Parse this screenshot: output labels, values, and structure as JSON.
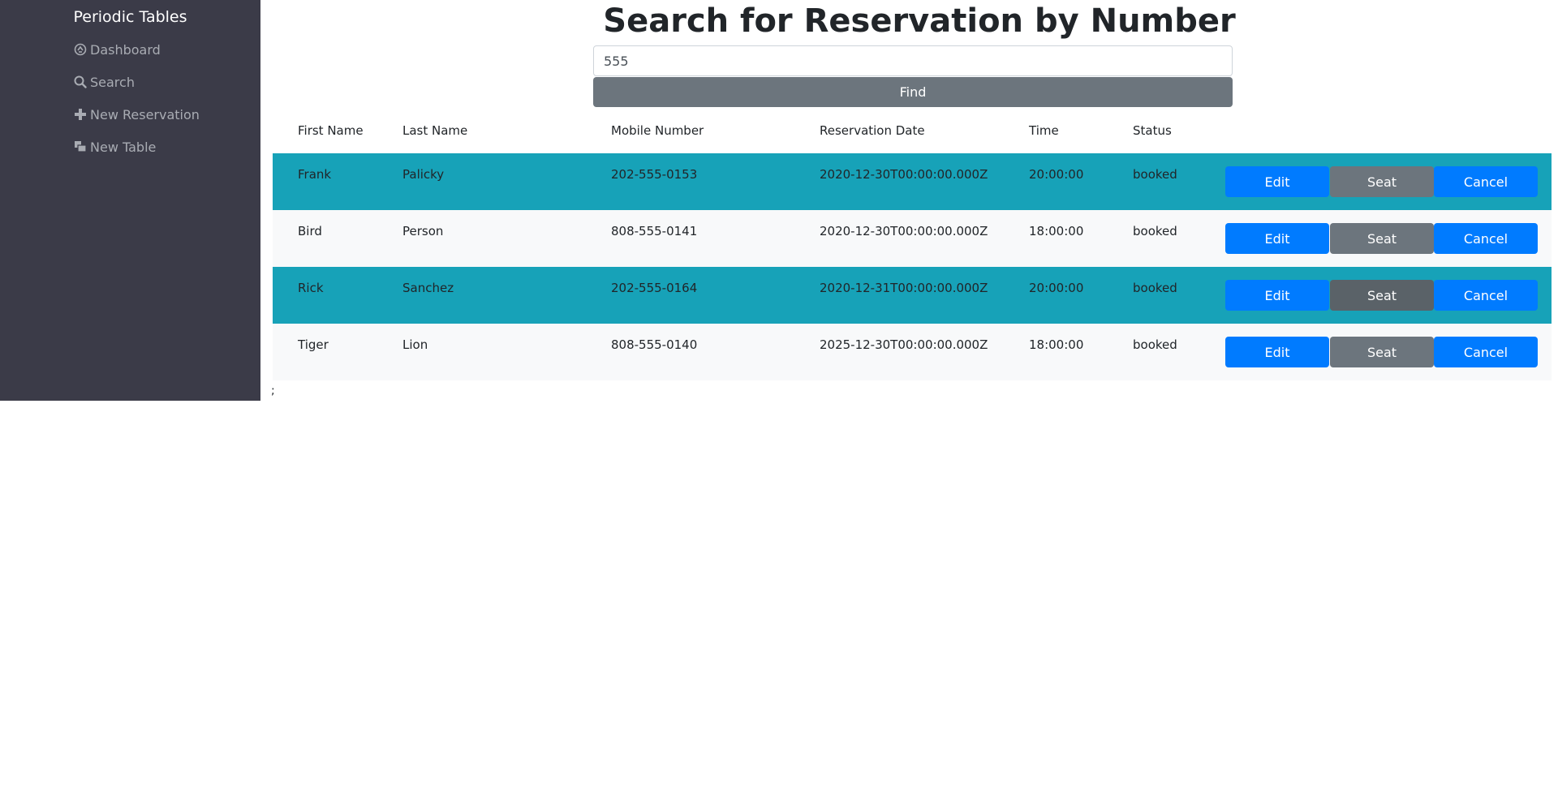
{
  "sidebar": {
    "brand": "Periodic Tables",
    "items": [
      {
        "label": "Dashboard",
        "icon": "dashboard-icon"
      },
      {
        "label": "Search",
        "icon": "search-icon"
      },
      {
        "label": "New Reservation",
        "icon": "plus-icon"
      },
      {
        "label": "New Table",
        "icon": "layers-icon"
      }
    ]
  },
  "main": {
    "title": "Search for Reservation by Number",
    "search": {
      "value": "555",
      "placeholder": ""
    },
    "find_label": "Find",
    "stray_text": ";"
  },
  "table": {
    "headers": [
      "First Name",
      "Last Name",
      "Mobile Number",
      "Reservation Date",
      "Time",
      "Status"
    ],
    "rows": [
      {
        "first": "Frank",
        "last": "Palicky",
        "mobile": "202-555-0153",
        "date": "2020-12-30T00:00:00.000Z",
        "time": "20:00:00",
        "status": "booked"
      },
      {
        "first": "Bird",
        "last": "Person",
        "mobile": "808-555-0141",
        "date": "2020-12-30T00:00:00.000Z",
        "time": "18:00:00",
        "status": "booked"
      },
      {
        "first": "Rick",
        "last": "Sanchez",
        "mobile": "202-555-0164",
        "date": "2020-12-31T00:00:00.000Z",
        "time": "20:00:00",
        "status": "booked"
      },
      {
        "first": "Tiger",
        "last": "Lion",
        "mobile": "808-555-0140",
        "date": "2025-12-30T00:00:00.000Z",
        "time": "18:00:00",
        "status": "booked"
      }
    ],
    "actions": {
      "edit": "Edit",
      "seat": "Seat",
      "cancel": "Cancel"
    }
  },
  "colors": {
    "sidebar_bg": "#3b3b48",
    "row_highlight": "#17a2b8",
    "row_light": "#f8f9fa",
    "primary": "#007bff",
    "secondary": "#6c757d"
  }
}
